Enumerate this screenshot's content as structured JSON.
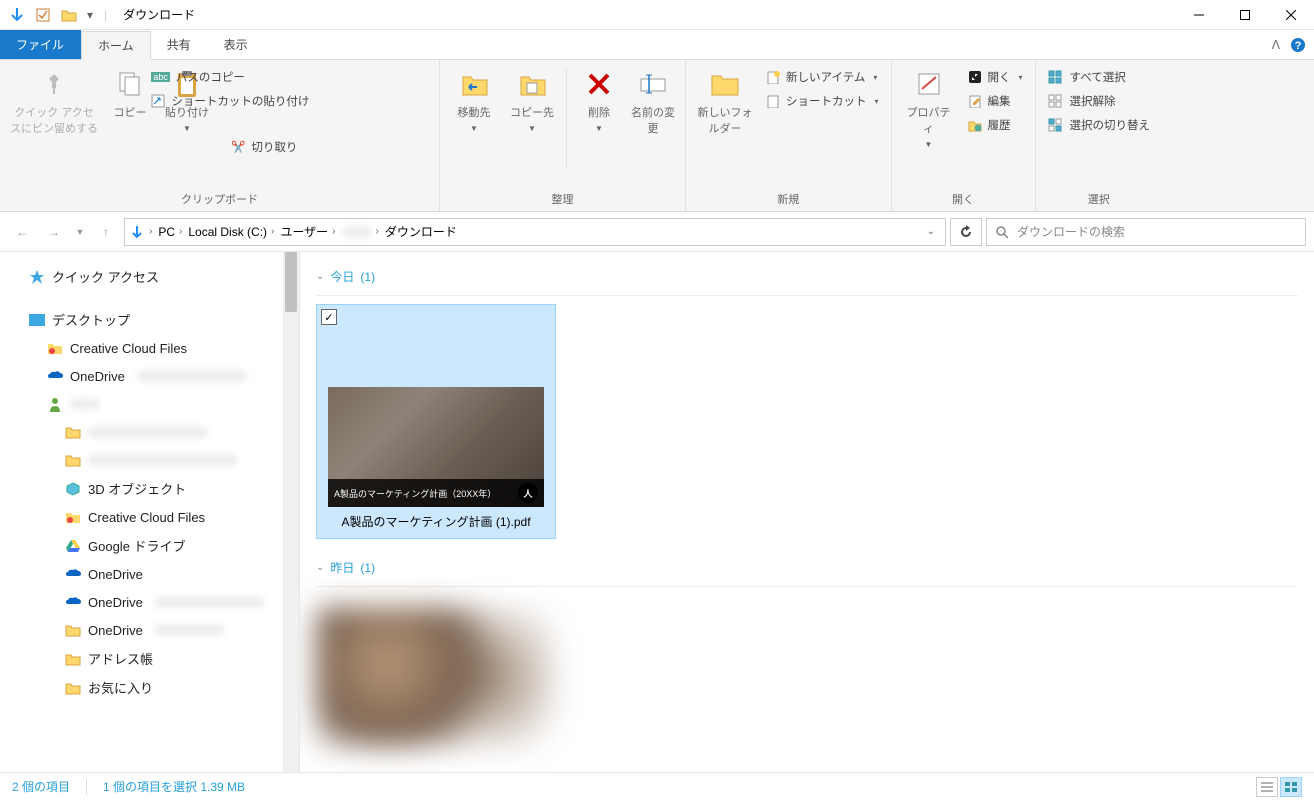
{
  "window": {
    "title": "ダウンロード"
  },
  "tabs": {
    "file": "ファイル",
    "home": "ホーム",
    "share": "共有",
    "view": "表示"
  },
  "ribbon": {
    "clipboard": {
      "label": "クリップボード",
      "pin": "クイック アクセスにピン留めする",
      "copy": "コピー",
      "paste": "貼り付け",
      "cut": "切り取り",
      "copypath": "パスのコピー",
      "pasteshortcut": "ショートカットの貼り付け"
    },
    "organize": {
      "label": "整理",
      "moveto": "移動先",
      "copyto": "コピー先",
      "delete": "削除",
      "rename": "名前の変更"
    },
    "new": {
      "label": "新規",
      "newfolder": "新しいフォルダー",
      "newitem": "新しいアイテム",
      "shortcut": "ショートカット"
    },
    "open": {
      "label": "開く",
      "properties": "プロパティ",
      "open": "開く",
      "edit": "編集",
      "history": "履歴"
    },
    "select": {
      "label": "選択",
      "selectall": "すべて選択",
      "selectnone": "選択解除",
      "invert": "選択の切り替え"
    }
  },
  "breadcrumb": {
    "items": [
      "PC",
      "Local Disk (C:)",
      "ユーザー",
      "",
      "ダウンロード"
    ]
  },
  "search": {
    "placeholder": "ダウンロードの検索"
  },
  "sidebar": {
    "quickaccess": "クイック アクセス",
    "desktop": "デスクトップ",
    "ccfiles": "Creative Cloud Files",
    "onedrive": "OneDrive",
    "objects3d": "3D オブジェクト",
    "ccfiles2": "Creative Cloud Files",
    "gdrive": "Google ドライブ",
    "onedrive2": "OneDrive",
    "onedrive3": "OneDrive",
    "onedrive4": "OneDrive",
    "addressbook": "アドレス帳",
    "favorites": "お気に入り"
  },
  "content": {
    "groups": {
      "today": {
        "label": "今日",
        "count": "(1)"
      },
      "yesterday": {
        "label": "昨日",
        "count": "(1)"
      }
    },
    "file": {
      "name": "A製品のマーケティング計画 (1).pdf",
      "thumbtitle": "A製品のマーケティング計画（20XX年）"
    }
  },
  "statusbar": {
    "count": "2 個の項目",
    "selected": "1 個の項目を選択 1.39 MB"
  }
}
